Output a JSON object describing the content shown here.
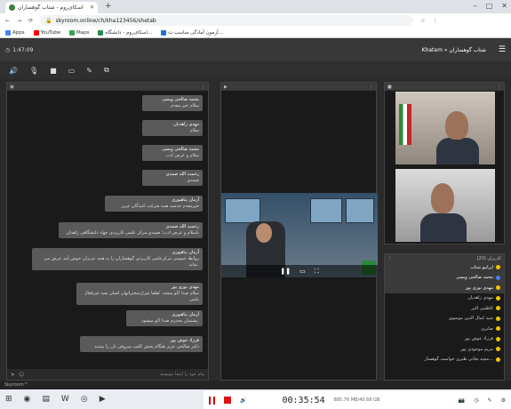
{
  "browser": {
    "tab_title": "اسکای‌روم - شتاب گوهساران",
    "url": "skyroom.online/ch/kha123456/shetab",
    "bookmarks": [
      "Apps",
      "YouTube",
      "Maps",
      "اسکای‌روم - دانشگاه...",
      "آزمون آمادگی مناسب ت..."
    ]
  },
  "app": {
    "time": "1:47:09",
    "title": "Khatam » شتاب گوهساران"
  },
  "chat": {
    "messages": [
      {
        "name": "محمد صالحی ویسی",
        "text": "سلام خیر مقدم"
      },
      {
        "name": "مهدی زاهدیان",
        "text": "سلام"
      },
      {
        "name": "محمد صالحی ویسی",
        "text": "سلام و عرض ادب"
      },
      {
        "name": "رحمت الله صمدی",
        "text": "صمدی"
      },
      {
        "name": "آرمان پناهپوری",
        "text": "خیرمقدم خدمت همه شرکت کنندگان عزیز"
      },
      {
        "name": "رحمت الله صمدی",
        "text": "باسلام و عرض ادب؛ صمدی،مرکز علمی کاربردی جهاد دانشگاهی زاهدان"
      },
      {
        "name": "آرمان پناهپوری",
        "text": "روابط عمومی مرکزعلمی کاربردی گوهساران را به همه عزیزان خوش آمد عرض می نماید."
      },
      {
        "name": "مهدی نوری پور",
        "text": "سلام صدا اکو میشه. لطفا غیرازسخنرانهان اصلی بقیه غیرفعال باشن"
      },
      {
        "name": "آرمان پناهپوری",
        "text": "پشتیبان محترم صدا اکو میشود."
      },
      {
        "name": "فرزاد عوض پور",
        "text": "دکتر صالحی عزیز هنگام پخش کلیپ میروفن تان را ببندید"
      }
    ],
    "input_placeholder": "پیام خود را اینجا بنویسید"
  },
  "users": {
    "header": "کاربران (20)",
    "list": [
      {
        "name": "ایرانیو شتاب",
        "highlight": true,
        "color": "#f2c400"
      },
      {
        "name": "محمد صالحی ویسی",
        "highlight": true,
        "color": "#3b82f6"
      },
      {
        "name": "مهدی نوری پور",
        "highlight": true,
        "color": "#f2c400"
      },
      {
        "name": "مهدی زاهدیان",
        "highlight": false,
        "color": "#f2c400"
      },
      {
        "name": "کاظمی اکبر",
        "highlight": false,
        "color": "#f2c400"
      },
      {
        "name": "سید کمال الدین موسوی",
        "highlight": false,
        "color": "#f2c400"
      },
      {
        "name": "صابری",
        "highlight": false,
        "color": "#f2c400"
      },
      {
        "name": "فرزاد عوض پور",
        "highlight": false,
        "color": "#f2c400"
      },
      {
        "name": "مریم موحودی پور",
        "highlight": false,
        "color": "#f2c400"
      },
      {
        "name": "مجید نجاتی طبری خواست گوهسار...",
        "highlight": false,
        "color": "#f2c400"
      }
    ]
  },
  "statusbar": {
    "brand": "Skyroom™"
  },
  "recorder": {
    "elapsed": "00:35:54",
    "size": "885.76 MB/40.68 GB"
  },
  "colors": {
    "accent": "#f2c400",
    "record": "#d11111"
  }
}
